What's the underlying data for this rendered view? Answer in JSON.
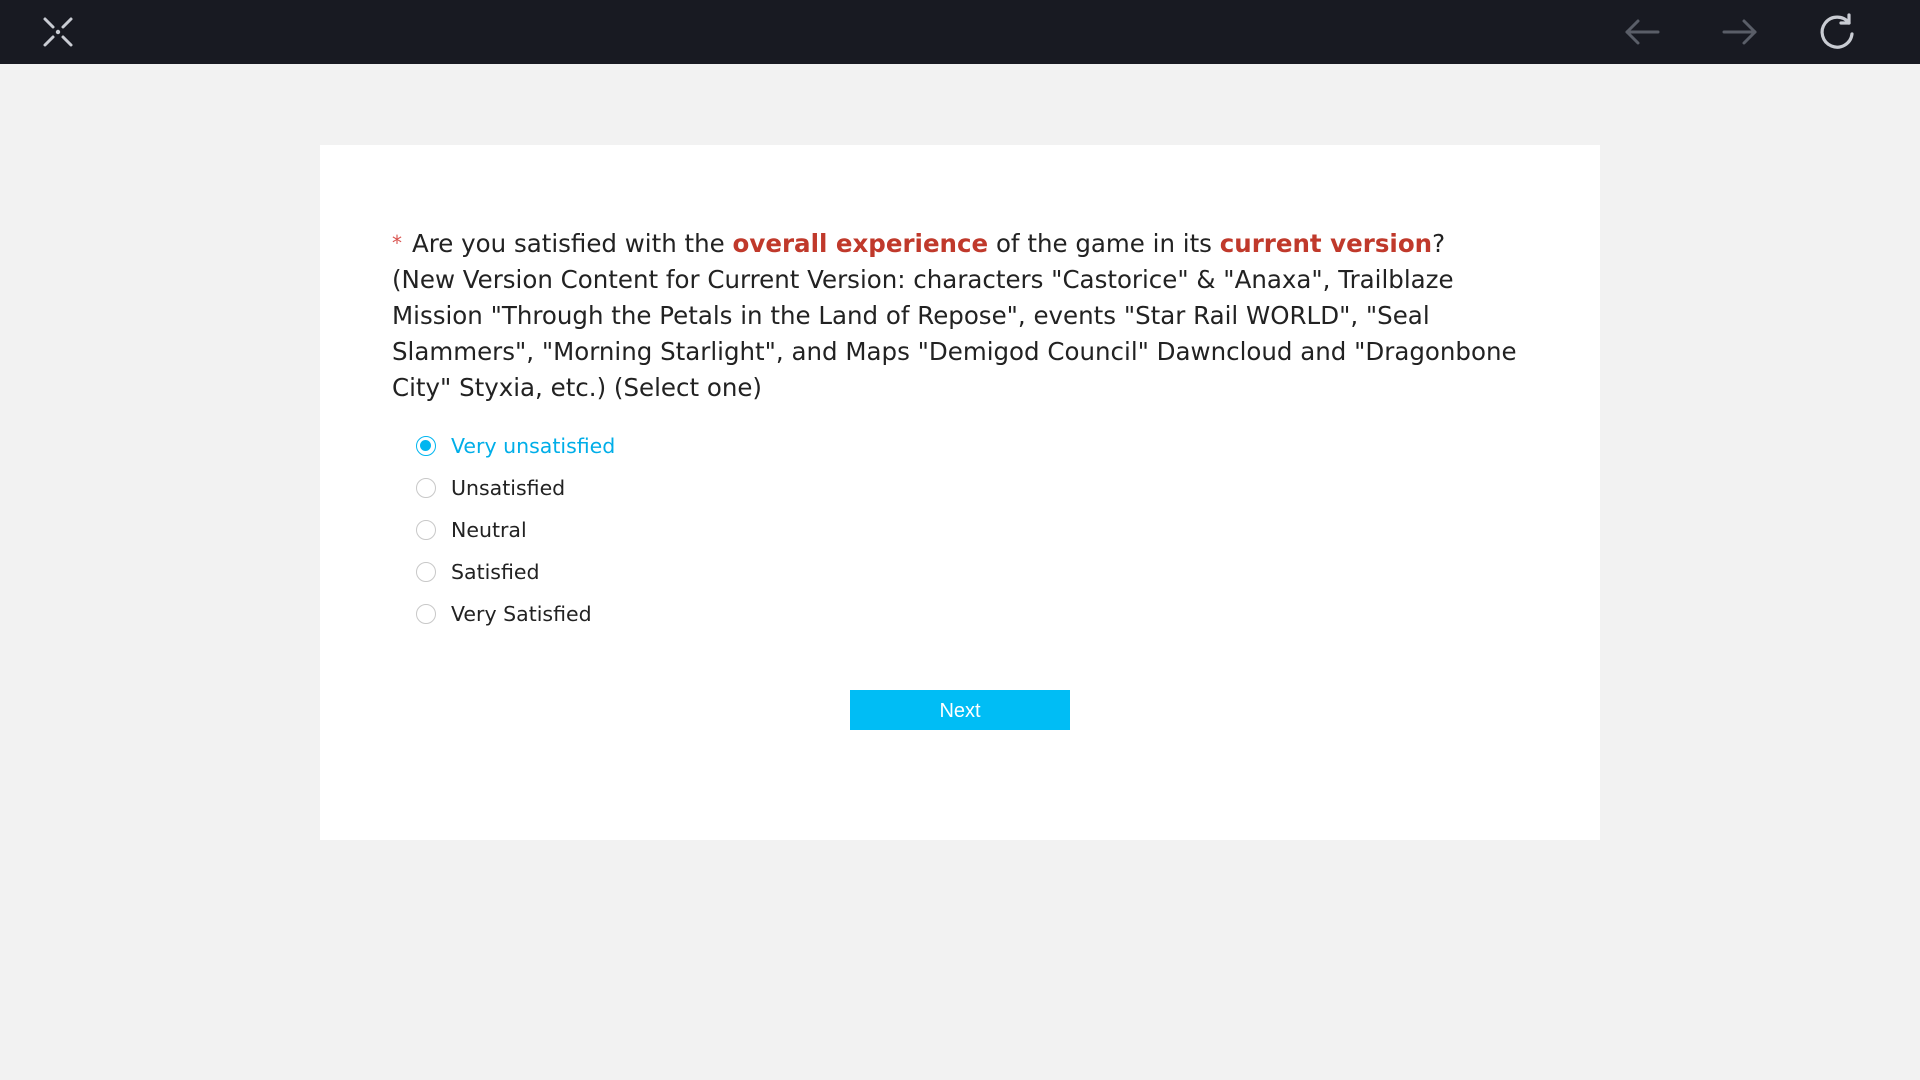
{
  "toolbar": {
    "close_icon": "close-x-icon",
    "back_icon": "arrow-left-icon",
    "forward_icon": "arrow-right-icon",
    "reload_icon": "reload-icon"
  },
  "question": {
    "required_mark": "*",
    "part1": "Are you satisfied with the ",
    "highlight1": "overall experience",
    "part2": " of the game in its ",
    "highlight2": "current version",
    "part3": "?",
    "details": "(New Version Content for Current Version: characters \"Castorice\" & \"Anaxa\", Trailblaze Mission \"Through the Petals in the Land of Repose\", events \"Star Rail WORLD\", \"Seal Slammers\", \"Morning Starlight\", and Maps \"Demigod Council\" Dawncloud and \"Dragonbone City\" Styxia, etc.)  (Select one)"
  },
  "options": [
    {
      "label": "Very unsatisfied",
      "checked": true
    },
    {
      "label": "Unsatisfied",
      "checked": false
    },
    {
      "label": "Neutral",
      "checked": false
    },
    {
      "label": "Satisfied",
      "checked": false
    },
    {
      "label": "Very Satisfied",
      "checked": false
    }
  ],
  "next_button": {
    "label": "Next"
  },
  "colors": {
    "topbar": "#181a22",
    "accent": "#00bdf5",
    "highlight": "#c0392b",
    "background": "#f2f2f2"
  }
}
